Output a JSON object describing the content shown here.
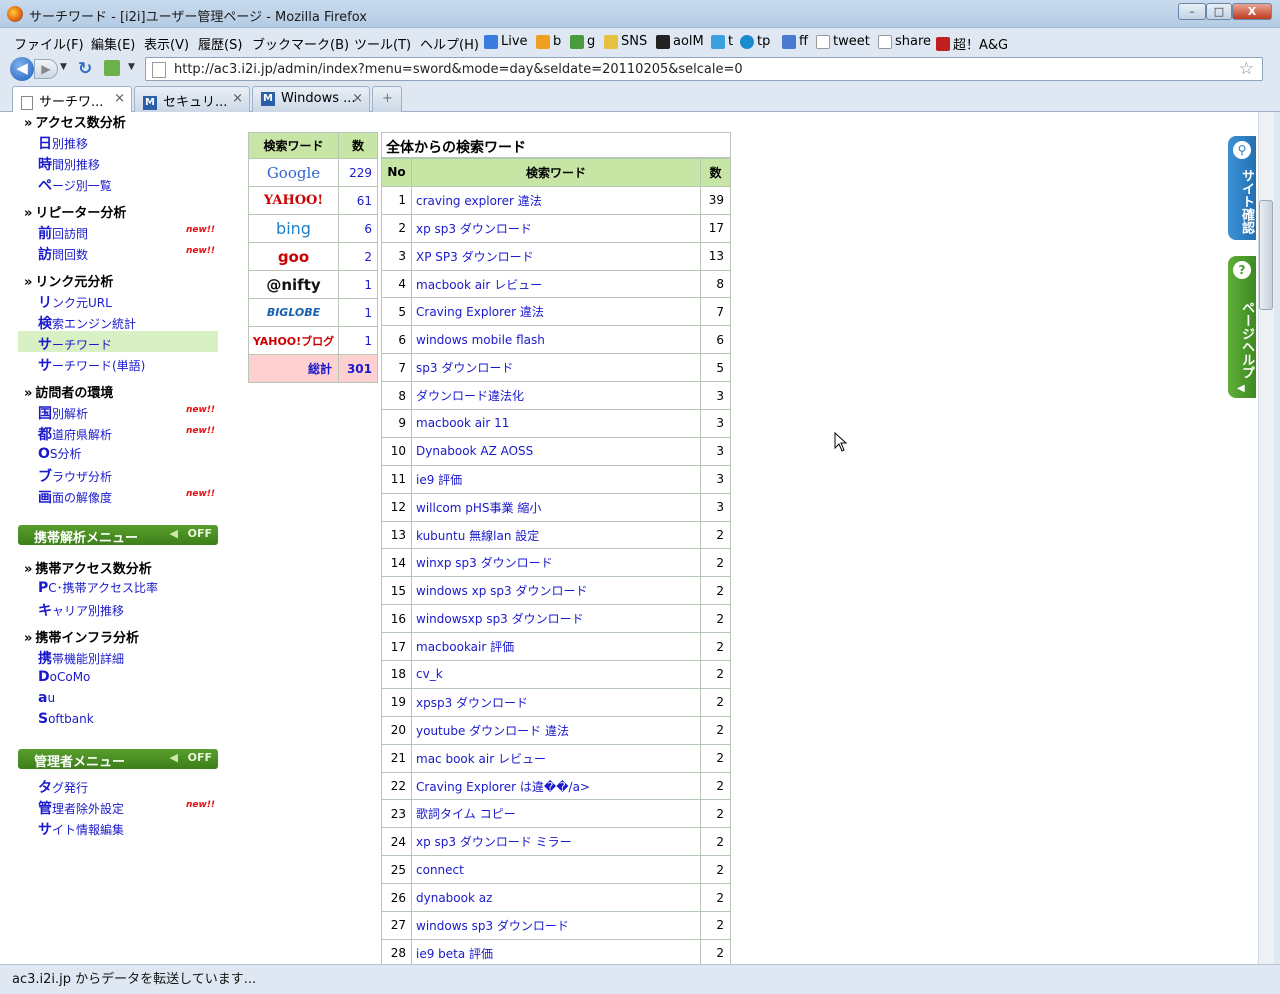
{
  "window": {
    "title": "サーチワード - [i2i]ユーザー管理ページ - Mozilla Firefox",
    "minimize": "–",
    "maximize": "□",
    "close": "X"
  },
  "menu": [
    "ファイル(F)",
    "編集(E)",
    "表示(V)",
    "履歴(S)",
    "ブックマーク(B)",
    "ツール(T)",
    "ヘルプ(H)"
  ],
  "bookmarks": [
    {
      "label": "Live",
      "color": "#3a7be0"
    },
    {
      "label": "b",
      "color": "#f0a020"
    },
    {
      "label": "g",
      "color": "#4a9a40"
    },
    {
      "label": "SNS",
      "color": "#e8c040"
    },
    {
      "label": "aolM",
      "color": "#222222"
    },
    {
      "label": "t",
      "color": "#3aa0e0"
    },
    {
      "label": "tp",
      "color": "#1b8ad0"
    },
    {
      "label": "ff",
      "color": "#4a7ad0"
    },
    {
      "label": "tweet",
      "color": "#ffffff"
    },
    {
      "label": "share",
      "color": "#ffffff"
    },
    {
      "label": "超！A&G",
      "color": "#c02020"
    }
  ],
  "nav": {
    "back": "◀",
    "forward": "▶",
    "url": "http://ac3.i2i.jp/admin/index?menu=sword&mode=day&seldate=20110205&selcale=0",
    "star": "☆"
  },
  "tabs": [
    {
      "label": "サーチワ...",
      "active": true
    },
    {
      "label": "セキュリ...",
      "active": false
    },
    {
      "label": "Windows ...",
      "active": false
    }
  ],
  "tab_close": "×",
  "tab_new": "+",
  "sidebar": {
    "sections": [
      {
        "title": "アクセス数分析",
        "items": [
          {
            "first": "日",
            "rest": "別推移",
            "badge": false
          },
          {
            "first": "時",
            "rest": "間別推移",
            "badge": false
          },
          {
            "first": "ペ",
            "rest": "ージ別一覧",
            "badge": false
          }
        ]
      },
      {
        "title": "リピーター分析",
        "items": [
          {
            "first": "前",
            "rest": "回訪問",
            "badge": true
          },
          {
            "first": "訪",
            "rest": "問回数",
            "badge": true
          }
        ]
      },
      {
        "title": "リンク元分析",
        "items": [
          {
            "first": "リ",
            "rest": "ンク元URL",
            "badge": false
          },
          {
            "first": "検",
            "rest": "索エンジン統計",
            "badge": false
          },
          {
            "first": "サ",
            "rest": "ーチワード",
            "badge": false,
            "selected": true
          },
          {
            "first": "サ",
            "rest": "ーチワード(単語)",
            "badge": false
          }
        ]
      },
      {
        "title": "訪問者の環境",
        "items": [
          {
            "first": "国",
            "rest": "別解析",
            "badge": true
          },
          {
            "first": "都",
            "rest": "道府県解析",
            "badge": true
          },
          {
            "first": "O",
            "rest": "S分析",
            "badge": false
          },
          {
            "first": "ブ",
            "rest": "ラウザ分析",
            "badge": false
          },
          {
            "first": "画",
            "rest": "面の解像度",
            "badge": true
          }
        ]
      }
    ],
    "mobile_menu": {
      "label": "携帯解析メニュー",
      "toggle": "OFF"
    },
    "mobile_sections": [
      {
        "title": "携帯アクセス数分析",
        "items": [
          {
            "first": "P",
            "rest": "C･携帯アクセス比率",
            "badge": false
          },
          {
            "first": "キ",
            "rest": "ャリア別推移",
            "badge": false
          }
        ]
      },
      {
        "title": "携帯インフラ分析",
        "items": [
          {
            "first": "携",
            "rest": "帯機能別詳細",
            "badge": false
          },
          {
            "first": "D",
            "rest": "oCoMo",
            "badge": false
          },
          {
            "first": "a",
            "rest": "u",
            "badge": false
          },
          {
            "first": "S",
            "rest": "oftbank",
            "badge": false
          }
        ]
      }
    ],
    "admin_menu": {
      "label": "管理者メニュー",
      "toggle": "OFF"
    },
    "admin_items": [
      {
        "first": "タ",
        "rest": "グ発行",
        "badge": false
      },
      {
        "first": "管",
        "rest": "理者除外設定",
        "badge": true
      },
      {
        "first": "サ",
        "rest": "イト情報編集",
        "badge": false
      }
    ],
    "new_badge": "new!!"
  },
  "engines": {
    "header": [
      "検索ワード",
      "数"
    ],
    "rows": [
      {
        "name": "Google",
        "count": "229",
        "color": "#3366cc"
      },
      {
        "name": "YAHOO!",
        "count": "61",
        "color": "#cc0000"
      },
      {
        "name": "bing",
        "count": "6",
        "color": "#1e7fc8"
      },
      {
        "name": "goo",
        "count": "2",
        "color": "#cc0000"
      },
      {
        "name": "@nifty",
        "count": "1",
        "color": "#111111"
      },
      {
        "name": "BIGLOBE",
        "count": "1",
        "color": "#1560b0"
      },
      {
        "name": "YAHOO!ブログ",
        "count": "1",
        "color": "#cc0000"
      }
    ],
    "total_label": "総計",
    "total": "301"
  },
  "main": {
    "title": "全体からの検索ワード",
    "header": [
      "No",
      "検索ワード",
      "数"
    ],
    "rows": [
      [
        "1",
        "craving explorer 違法",
        "39"
      ],
      [
        "2",
        "xp sp3 ダウンロード",
        "17"
      ],
      [
        "3",
        "XP SP3 ダウンロード",
        "13"
      ],
      [
        "4",
        "macbook air レビュー",
        "8"
      ],
      [
        "5",
        "Craving Explorer 違法",
        "7"
      ],
      [
        "6",
        "windows mobile flash",
        "6"
      ],
      [
        "7",
        "sp3 ダウンロード",
        "5"
      ],
      [
        "8",
        "ダウンロード違法化",
        "3"
      ],
      [
        "9",
        "macbook air 11",
        "3"
      ],
      [
        "10",
        "Dynabook AZ AOSS",
        "3"
      ],
      [
        "11",
        "ie9 評価",
        "3"
      ],
      [
        "12",
        "willcom pHS事業 縮小",
        "3"
      ],
      [
        "13",
        "kubuntu 無線lan 設定",
        "2"
      ],
      [
        "14",
        "winxp sp3 ダウンロード",
        "2"
      ],
      [
        "15",
        "windows xp sp3 ダウンロード",
        "2"
      ],
      [
        "16",
        "windowsxp sp3 ダウンロード",
        "2"
      ],
      [
        "17",
        "macbookair 評価",
        "2"
      ],
      [
        "18",
        "cv_k",
        "2"
      ],
      [
        "19",
        "xpsp3 ダウンロード",
        "2"
      ],
      [
        "20",
        "youtube ダウンロード 違法",
        "2"
      ],
      [
        "21",
        "mac book air レビュー",
        "2"
      ],
      [
        "22",
        "Craving Explorer は違��/a>",
        "2"
      ],
      [
        "23",
        "歌詞タイム コピー",
        "2"
      ],
      [
        "24",
        "xp sp3 ダウンロード ミラー",
        "2"
      ],
      [
        "25",
        "connect",
        "2"
      ],
      [
        "26",
        "dynabook az",
        "2"
      ],
      [
        "27",
        "windows sp3 ダウンロード",
        "2"
      ],
      [
        "28",
        "ie9 beta 評価",
        "2"
      ]
    ]
  },
  "side_tabs": [
    {
      "label": "サイト確認",
      "icon": "🔍",
      "color": "#2b7fc4"
    },
    {
      "label": "ページヘルプ",
      "icon": "?",
      "color": "#4c9a2a"
    }
  ],
  "status": "ac3.i2i.jp からデータを転送しています..."
}
